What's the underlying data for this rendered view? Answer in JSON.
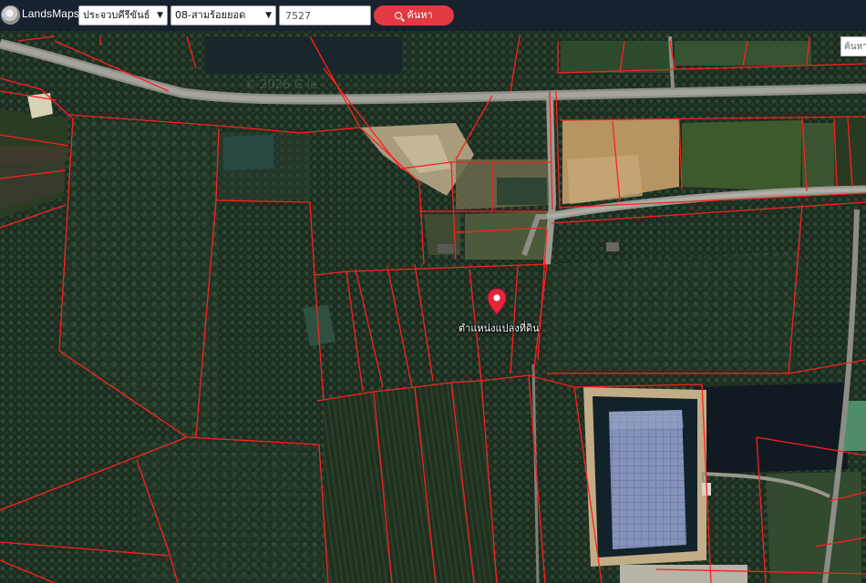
{
  "app": {
    "brand": "LandsMaps",
    "logo_icon": "department-of-lands-seal-icon"
  },
  "search_bar": {
    "province_value": "ประจวบคีรีขันธ์",
    "amphoe_value": "08-สามร้อยยอด",
    "parcel_number_value": "7527",
    "search_button_label": "ค้นหา",
    "search_button_icon": "search-icon",
    "accent_color": "#e13a43",
    "bar_color": "#18222f"
  },
  "map": {
    "watermark": "© 2026 G     ie",
    "map_search_placeholder": "ค้นหา",
    "marker_label": "ตำแหน่งแปลงที่ดิน",
    "marker_icon": "map-marker-icon",
    "parcel_line_color": "#ff1f1f",
    "imagery": "satellite"
  }
}
